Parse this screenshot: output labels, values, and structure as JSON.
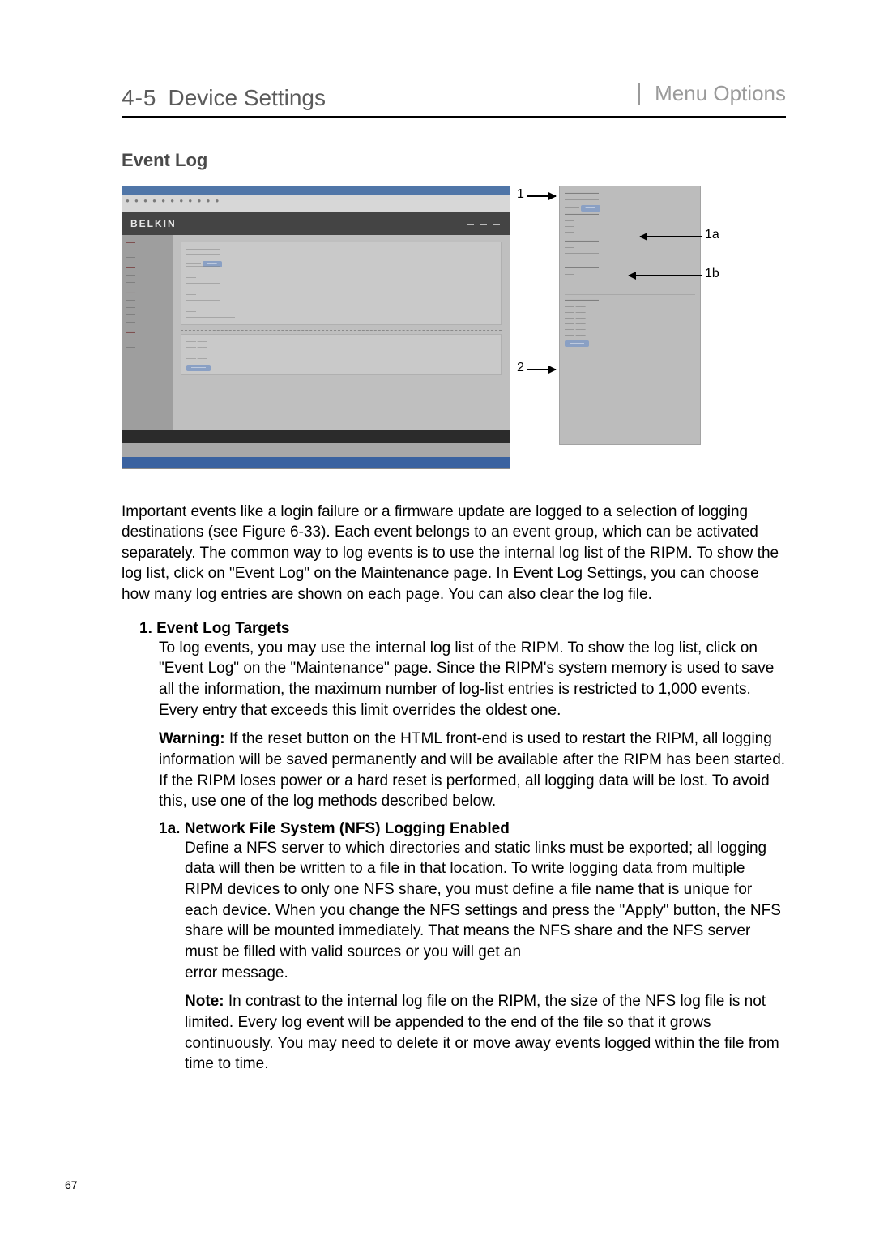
{
  "header": {
    "section_number": "4-5",
    "section_title": "Device Settings",
    "right_label": "Menu Options"
  },
  "heading": "Event Log",
  "figure": {
    "brand": "BELKIN",
    "labels": {
      "l1": "1",
      "l1a": "1a",
      "l1b": "1b",
      "l2": "2"
    }
  },
  "intro": "Important events like a login failure or a firmware update are logged to a selection of logging destinations (see Figure 6-33). Each event belongs to an event group, which can be activated separately. The common way to log events is to use the internal log list of the RIPM. To show the log list, click on \"Event Log\" on the Maintenance page. In Event Log Settings, you can choose how many log entries are shown on each page. You can also clear the log file.",
  "item1": {
    "num": "1.",
    "title": "Event Log Targets",
    "para1": "To log events, you may use the internal log list of the RIPM. To show the log list, click on \"Event Log\" on the \"Maintenance\" page. Since the RIPM's system memory is used to save all the information, the maximum number of log-list entries is restricted to 1,000 events. Every entry that exceeds this limit overrides the oldest one.",
    "warn_label": "Warning:",
    "para2": " If the reset button on the HTML front-end is used to restart the RIPM, all logging information will be saved permanently and will be available after the RIPM has been started. If the RIPM loses power or a hard reset is performed, all logging data will be lost. To avoid this, use one of the log methods described below."
  },
  "item1a": {
    "num_title": "1a. Network File System (NFS) Logging Enabled",
    "para1": "Define a NFS server to which directories and static links must be exported; all logging data will then be written to a file in that location. To write logging data from multiple RIPM devices to only one NFS share, you must define a file name that is unique for each device. When you change the NFS settings and press the \"Apply\" button, the NFS share will be mounted immediately. That means the NFS share and the NFS server must be filled with valid sources or you will get an",
    "para1b": "error message.",
    "note_label": "Note:",
    "para2": " In contrast to the internal log file on the RIPM, the size of the NFS log file is not limited. Every log event will be appended to the end of the file so that it grows continuously. You may need to delete it or move away events logged within the file from time to time."
  },
  "page_number": "67"
}
